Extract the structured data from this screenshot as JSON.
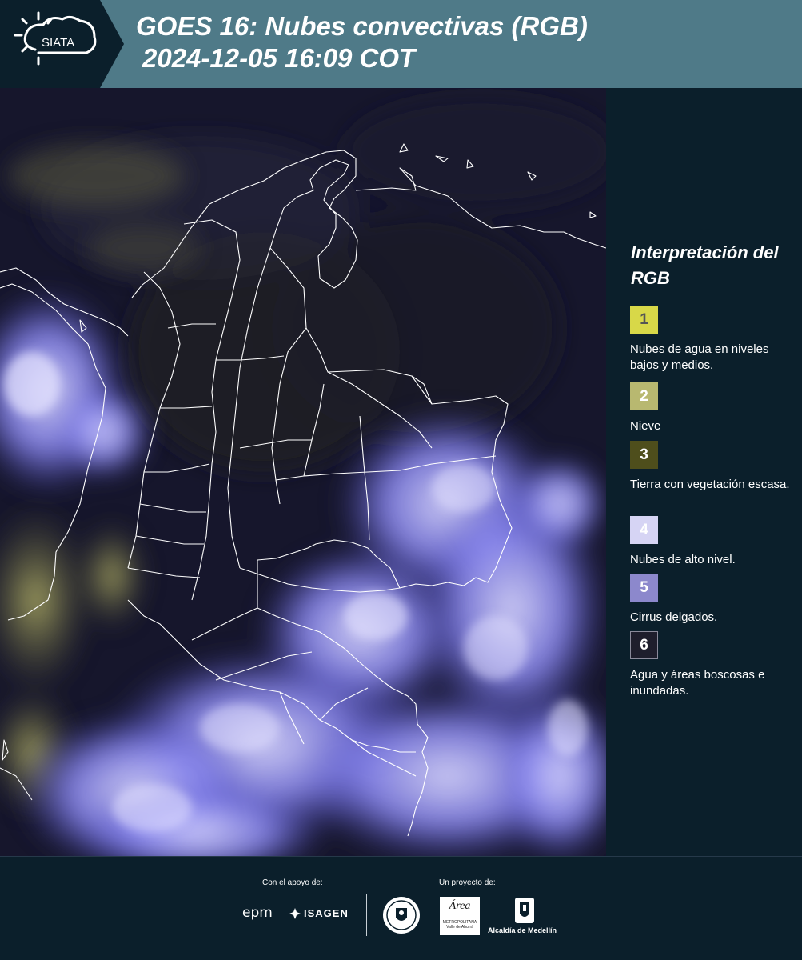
{
  "header": {
    "logo_text": "SIATA",
    "title_line1": "GOES 16: Nubes convectivas (RGB)",
    "title_line2": "2024-12-05 16:09 COT"
  },
  "map": {
    "description_icon": "satellite-map",
    "colors": {
      "background": "#14142a",
      "high_cloud": "#8c8cf2",
      "low_cloud": "#b0b060",
      "border": "#ffffff"
    }
  },
  "legend": {
    "title": "Interpretación del RGB",
    "items": [
      {
        "number": "1",
        "label": "Nubes de agua en niveles bajos y medios.",
        "color": "#d8d848",
        "text_color": "#555555"
      },
      {
        "number": "2",
        "label": "Nieve",
        "color": "#b8b870",
        "text_color": "#ffffff"
      },
      {
        "number": "3",
        "label": "Tierra con vegetación escasa.",
        "color": "#4e4e1c",
        "text_color": "#ffffff"
      },
      {
        "number": "4",
        "label": "Nubes de alto nivel.",
        "color": "#d6d4f4",
        "text_color": "#ffffff"
      },
      {
        "number": "5",
        "label": "Cirrus delgados.",
        "color": "#8c88cc",
        "text_color": "#ffffff"
      },
      {
        "number": "6",
        "label": "Agua y áreas boscosas e inundadas.",
        "color": "#1e1e2c",
        "text_color": "#ffffff"
      }
    ]
  },
  "footer": {
    "support_label": "Con el apoyo de:",
    "project_label": "Un proyecto de:",
    "epm": "epm",
    "isagen": "ISAGEN",
    "amva_name": "Área",
    "amva_sub": "METROPOLITANA Valle de Aburrá",
    "alcaldia": "Alcaldía de Medellín"
  }
}
